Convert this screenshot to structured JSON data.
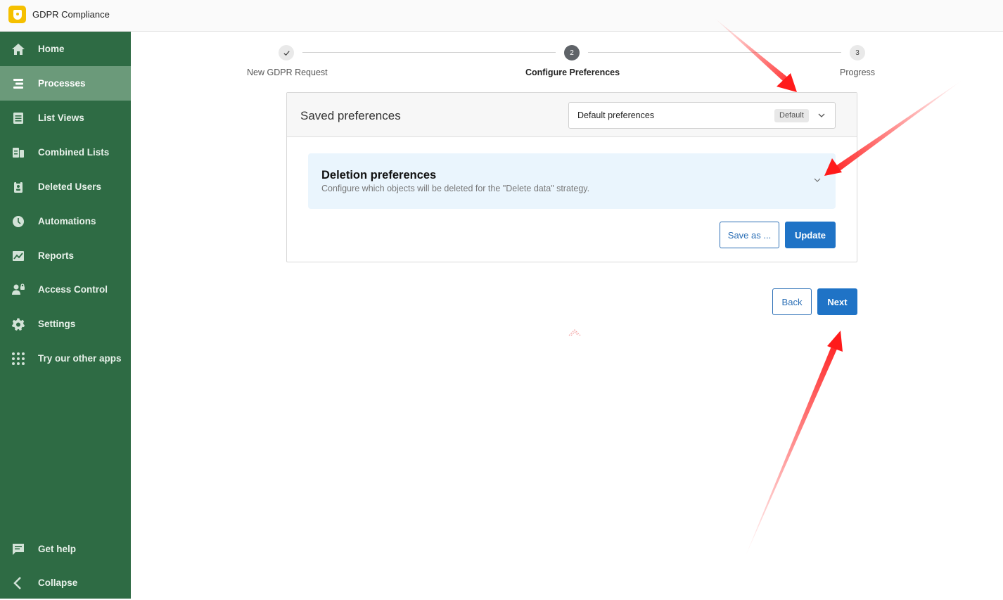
{
  "app": {
    "title": "GDPR Compliance"
  },
  "sidebar": {
    "items": [
      {
        "label": "Home",
        "icon": "home-icon"
      },
      {
        "label": "Processes",
        "icon": "processes-icon",
        "active": true
      },
      {
        "label": "List Views",
        "icon": "list-views-icon"
      },
      {
        "label": "Combined Lists",
        "icon": "combined-lists-icon"
      },
      {
        "label": "Deleted Users",
        "icon": "deleted-users-icon"
      },
      {
        "label": "Automations",
        "icon": "clock-icon"
      },
      {
        "label": "Reports",
        "icon": "reports-icon"
      },
      {
        "label": "Access Control",
        "icon": "access-control-icon"
      },
      {
        "label": "Settings",
        "icon": "gear-icon"
      },
      {
        "label": "Try our other apps",
        "icon": "apps-grid-icon"
      }
    ],
    "bottom": [
      {
        "label": "Get help",
        "icon": "help-chat-icon"
      },
      {
        "label": "Collapse",
        "icon": "chevron-left-icon"
      }
    ],
    "color": "#2e6b44",
    "active_color": "#6b9a7a"
  },
  "stepper": {
    "steps": [
      {
        "number": "✓",
        "label": "New GDPR Request",
        "state": "done"
      },
      {
        "number": "2",
        "label": "Configure Preferences",
        "state": "current"
      },
      {
        "number": "3",
        "label": "Progress",
        "state": "pending"
      }
    ]
  },
  "saved_preferences": {
    "title": "Saved preferences",
    "selected": "Default preferences",
    "badge": "Default"
  },
  "deletion_panel": {
    "title": "Deletion preferences",
    "description": "Configure which objects will be deleted for the \"Delete data\" strategy."
  },
  "card_actions": {
    "save_as": "Save as ...",
    "update": "Update"
  },
  "footer_actions": {
    "back": "Back",
    "next": "Next"
  },
  "accent_color": "#1f73c6"
}
